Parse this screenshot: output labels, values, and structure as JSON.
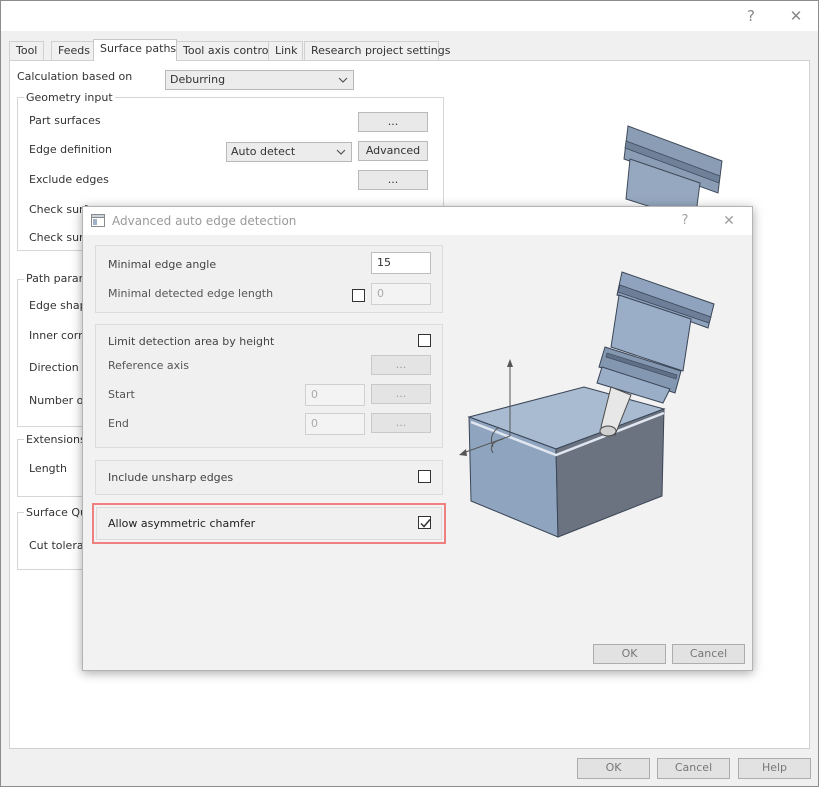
{
  "window": {
    "help_glyph": "?",
    "close_glyph": "✕"
  },
  "tabs": [
    {
      "label": "Tool"
    },
    {
      "label": "Feeds"
    },
    {
      "label": "Surface paths"
    },
    {
      "label": "Tool axis control"
    },
    {
      "label": "Link"
    },
    {
      "label": "Research project settings"
    }
  ],
  "calc": {
    "label": "Calculation based on",
    "value": "Deburring"
  },
  "geometry": {
    "title": "Geometry input",
    "part_surfaces": "Part surfaces",
    "edge_definition": "Edge definition",
    "edge_def_value": "Auto detect",
    "advanced_button": "Advanced",
    "exclude_edges": "Exclude edges",
    "check_surfaces_1": "Check surfa",
    "check_surfaces_2": "Check surfa",
    "ellipsis": "..."
  },
  "path_params": {
    "title": "Path parame",
    "edge_shape": "Edge shape",
    "inner_corner": "Inner corne",
    "direction": "Direction",
    "number_of": "Number of c"
  },
  "extensions": {
    "title": "Extensions/",
    "length": "Length"
  },
  "surface_quality": {
    "title": "Surface Qua",
    "cut_tolerance": "Cut toleranc"
  },
  "footer": {
    "ok": "OK",
    "cancel": "Cancel",
    "help": "Help"
  },
  "dialog": {
    "title": "Advanced auto edge detection",
    "help_glyph": "?",
    "close_glyph": "✕",
    "min_edge_angle": "Minimal edge angle",
    "min_edge_angle_value": "15",
    "min_detected_length": "Minimal detected edge length",
    "min_detected_length_value": "0",
    "limit_by_height": "Limit detection area by height",
    "reference_axis": "Reference axis",
    "start": "Start",
    "start_value": "0",
    "end": "End",
    "end_value": "0",
    "ellipsis": "...",
    "include_unsharp": "Include unsharp edges",
    "allow_asym": "Allow asymmetric chamfer",
    "allow_asym_checked": true,
    "ok": "OK",
    "cancel": "Cancel"
  }
}
